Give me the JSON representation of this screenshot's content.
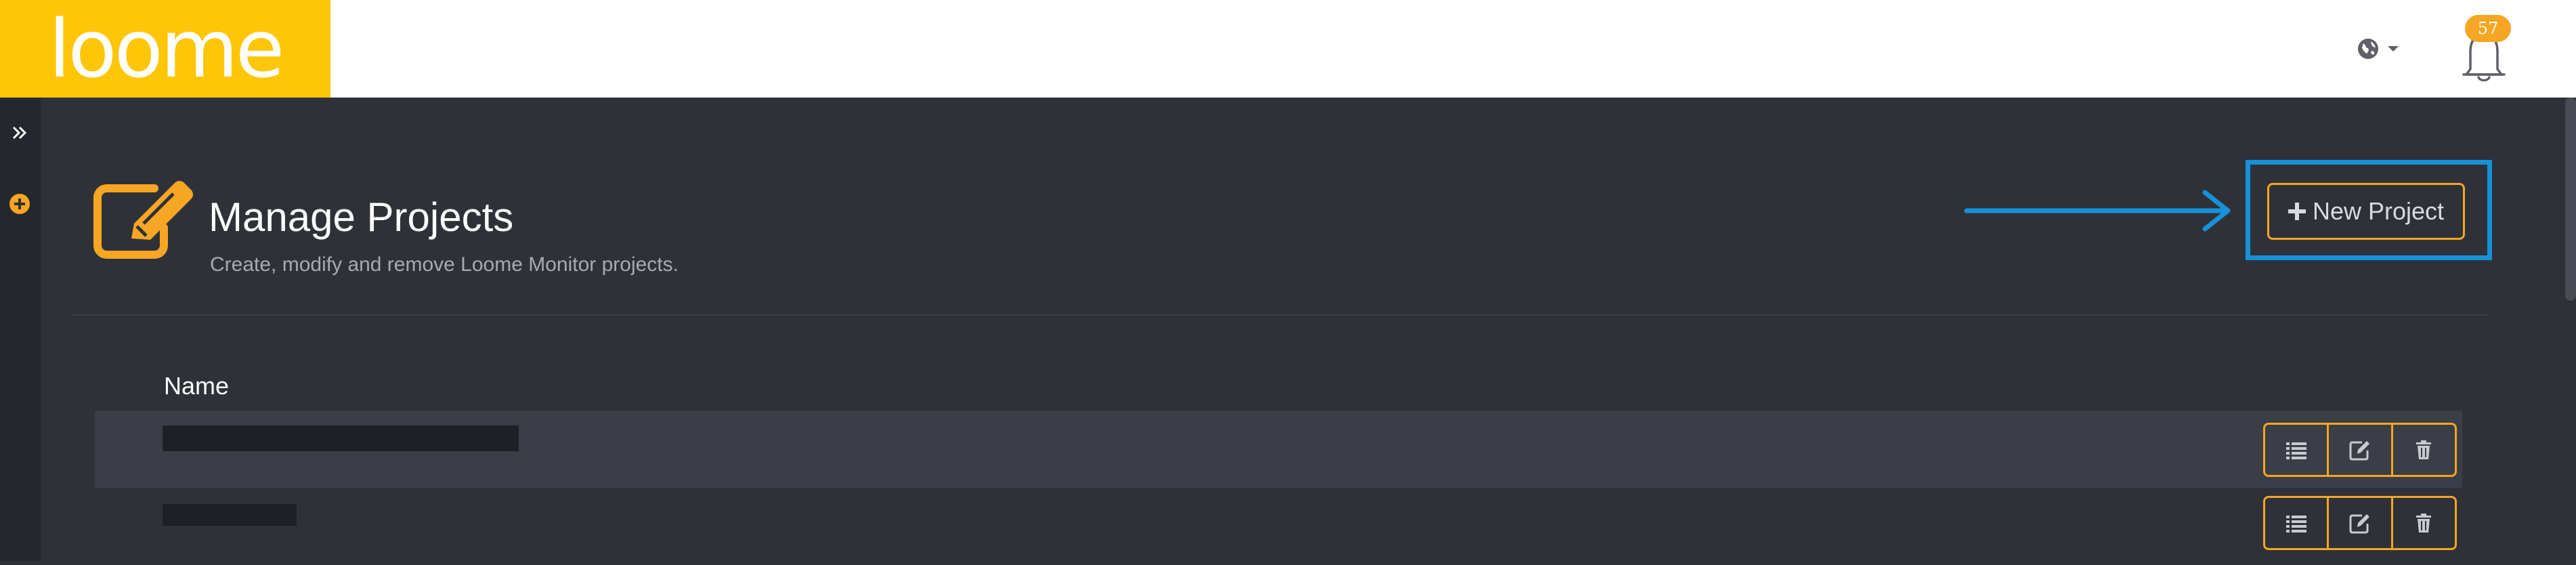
{
  "brand": {
    "logo_text": "loome",
    "logo_bg": "#ffc507"
  },
  "topbar": {
    "globe_icon": "globe-icon",
    "caret_icon": "caret-down-icon",
    "bell_icon": "bell-icon",
    "notification_count": "57"
  },
  "rail": {
    "expand_icon": "double-chevron-right-icon",
    "add_icon": "plus-circle-icon"
  },
  "header": {
    "icon": "edit-square-icon",
    "title": "Manage Projects",
    "subtitle": "Create, modify and remove Loome Monitor projects."
  },
  "toolbar": {
    "new_project_label": "New Project",
    "new_project_icon": "plus-icon"
  },
  "annotation": {
    "arrow_icon": "arrow-right-icon",
    "highlight_color": "#1592d8"
  },
  "table": {
    "columns": [
      "Name"
    ],
    "rows": [
      {
        "name": "",
        "actions": [
          "list-icon",
          "edit-icon",
          "trash-icon"
        ]
      },
      {
        "name": "",
        "actions": [
          "list-icon",
          "edit-icon",
          "trash-icon"
        ]
      }
    ]
  },
  "colors": {
    "accent": "#f5a623",
    "background": "#2f3139",
    "row_alt": "#3b3e47"
  }
}
